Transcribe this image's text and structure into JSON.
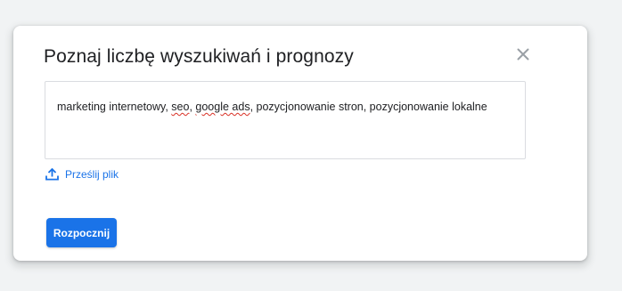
{
  "dialog": {
    "title": "Poznaj liczbę wyszukiwań i prognozy",
    "close_icon": "close-icon",
    "keywords": {
      "parts": [
        {
          "text": "marketing internetowy, ",
          "flagged": false
        },
        {
          "text": "seo",
          "flagged": true
        },
        {
          "text": ", ",
          "flagged": false
        },
        {
          "text": "google ads",
          "flagged": true
        },
        {
          "text": ", pozycjonowanie stron, pozycjonowanie lokalne",
          "flagged": false
        }
      ]
    },
    "upload": {
      "icon": "upload-icon",
      "label": "Prześlij plik"
    },
    "start_button_label": "Rozpocznij",
    "colors": {
      "accent": "#1a73e8",
      "spellcheck_underline": "#d93025",
      "close_icon": "#9aa0a6"
    }
  }
}
